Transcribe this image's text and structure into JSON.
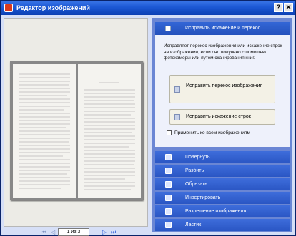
{
  "window": {
    "title": "Редактор изображений",
    "help_label": "?",
    "close_label": "✕"
  },
  "pager": {
    "first": "⏮",
    "prev": "◁",
    "page_label": "1 из 3",
    "next": "▷",
    "last": "⏭"
  },
  "panel": {
    "section_title": "Исправить искажение и перекос",
    "description": "Исправляет перекос изображения или искажение строк на изображении, если оно получено с помощью фотокамеры или путем сканирования книг.",
    "btn_fix_skew": "Исправить перекос изображения",
    "btn_fix_lines": "Исправить искажение строк",
    "apply_all": "Применить ко всем изображениям",
    "tools": [
      {
        "label": "Повернуть"
      },
      {
        "label": "Разбить"
      },
      {
        "label": "Обрезать"
      },
      {
        "label": "Инвертировать"
      },
      {
        "label": "Разрешение изображения"
      },
      {
        "label": "Ластик"
      }
    ]
  }
}
